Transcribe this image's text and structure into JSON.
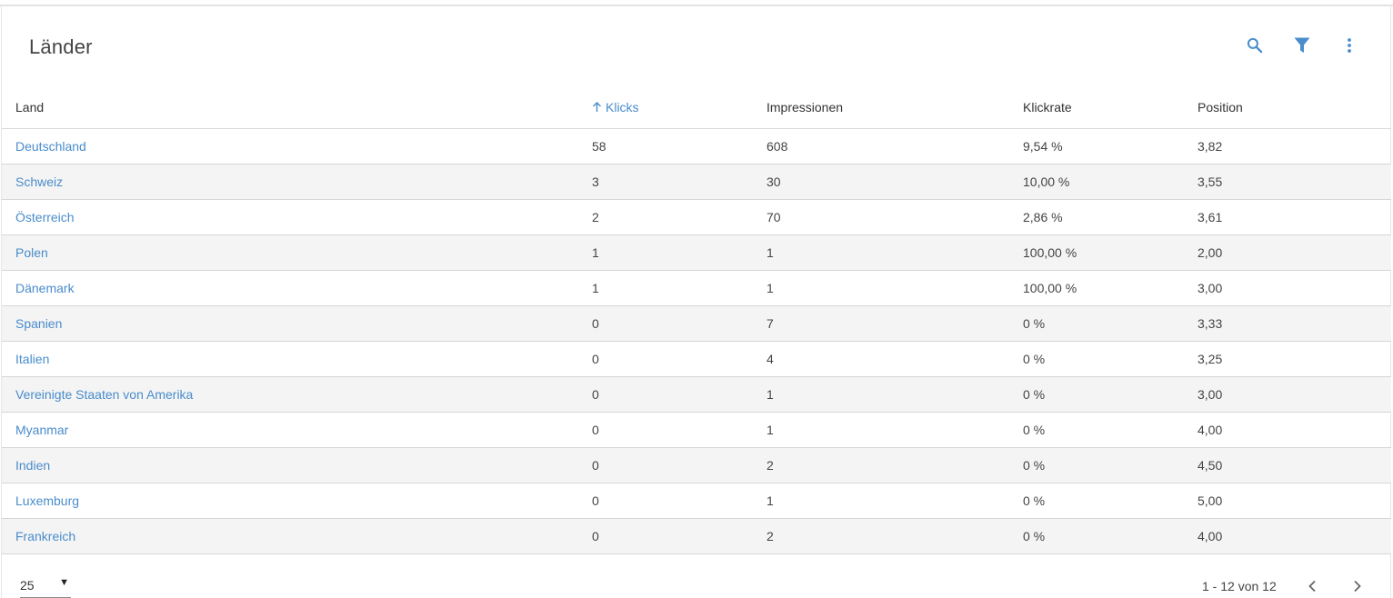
{
  "card": {
    "title": "Länder"
  },
  "toolbar": {
    "icons": [
      "search-icon",
      "filter-icon",
      "more-vert-icon"
    ],
    "accent": "#4a8ccc"
  },
  "table": {
    "headers": {
      "land": "Land",
      "klicks": "Klicks",
      "impressionen": "Impressionen",
      "klickrate": "Klickrate",
      "position": "Position"
    },
    "sorted_column": "klicks",
    "sort_direction": "ascending-arrow",
    "rows": [
      {
        "land": "Deutschland",
        "klicks": "58",
        "impressionen": "608",
        "klickrate": "9,54 %",
        "position": "3,82"
      },
      {
        "land": "Schweiz",
        "klicks": "3",
        "impressionen": "30",
        "klickrate": "10,00 %",
        "position": "3,55"
      },
      {
        "land": "Österreich",
        "klicks": "2",
        "impressionen": "70",
        "klickrate": "2,86 %",
        "position": "3,61"
      },
      {
        "land": "Polen",
        "klicks": "1",
        "impressionen": "1",
        "klickrate": "100,00 %",
        "position": "2,00"
      },
      {
        "land": "Dänemark",
        "klicks": "1",
        "impressionen": "1",
        "klickrate": "100,00 %",
        "position": "3,00"
      },
      {
        "land": "Spanien",
        "klicks": "0",
        "impressionen": "7",
        "klickrate": "0 %",
        "position": "3,33"
      },
      {
        "land": "Italien",
        "klicks": "0",
        "impressionen": "4",
        "klickrate": "0 %",
        "position": "3,25"
      },
      {
        "land": "Vereinigte Staaten von Amerika",
        "klicks": "0",
        "impressionen": "1",
        "klickrate": "0 %",
        "position": "3,00"
      },
      {
        "land": "Myanmar",
        "klicks": "0",
        "impressionen": "1",
        "klickrate": "0 %",
        "position": "4,00"
      },
      {
        "land": "Indien",
        "klicks": "0",
        "impressionen": "2",
        "klickrate": "0 %",
        "position": "4,50"
      },
      {
        "land": "Luxemburg",
        "klicks": "0",
        "impressionen": "1",
        "klickrate": "0 %",
        "position": "5,00"
      },
      {
        "land": "Frankreich",
        "klicks": "0",
        "impressionen": "2",
        "klickrate": "0 %",
        "position": "4,00"
      }
    ]
  },
  "footer": {
    "page_size": "25",
    "page_info": "1 - 12 von 12"
  }
}
